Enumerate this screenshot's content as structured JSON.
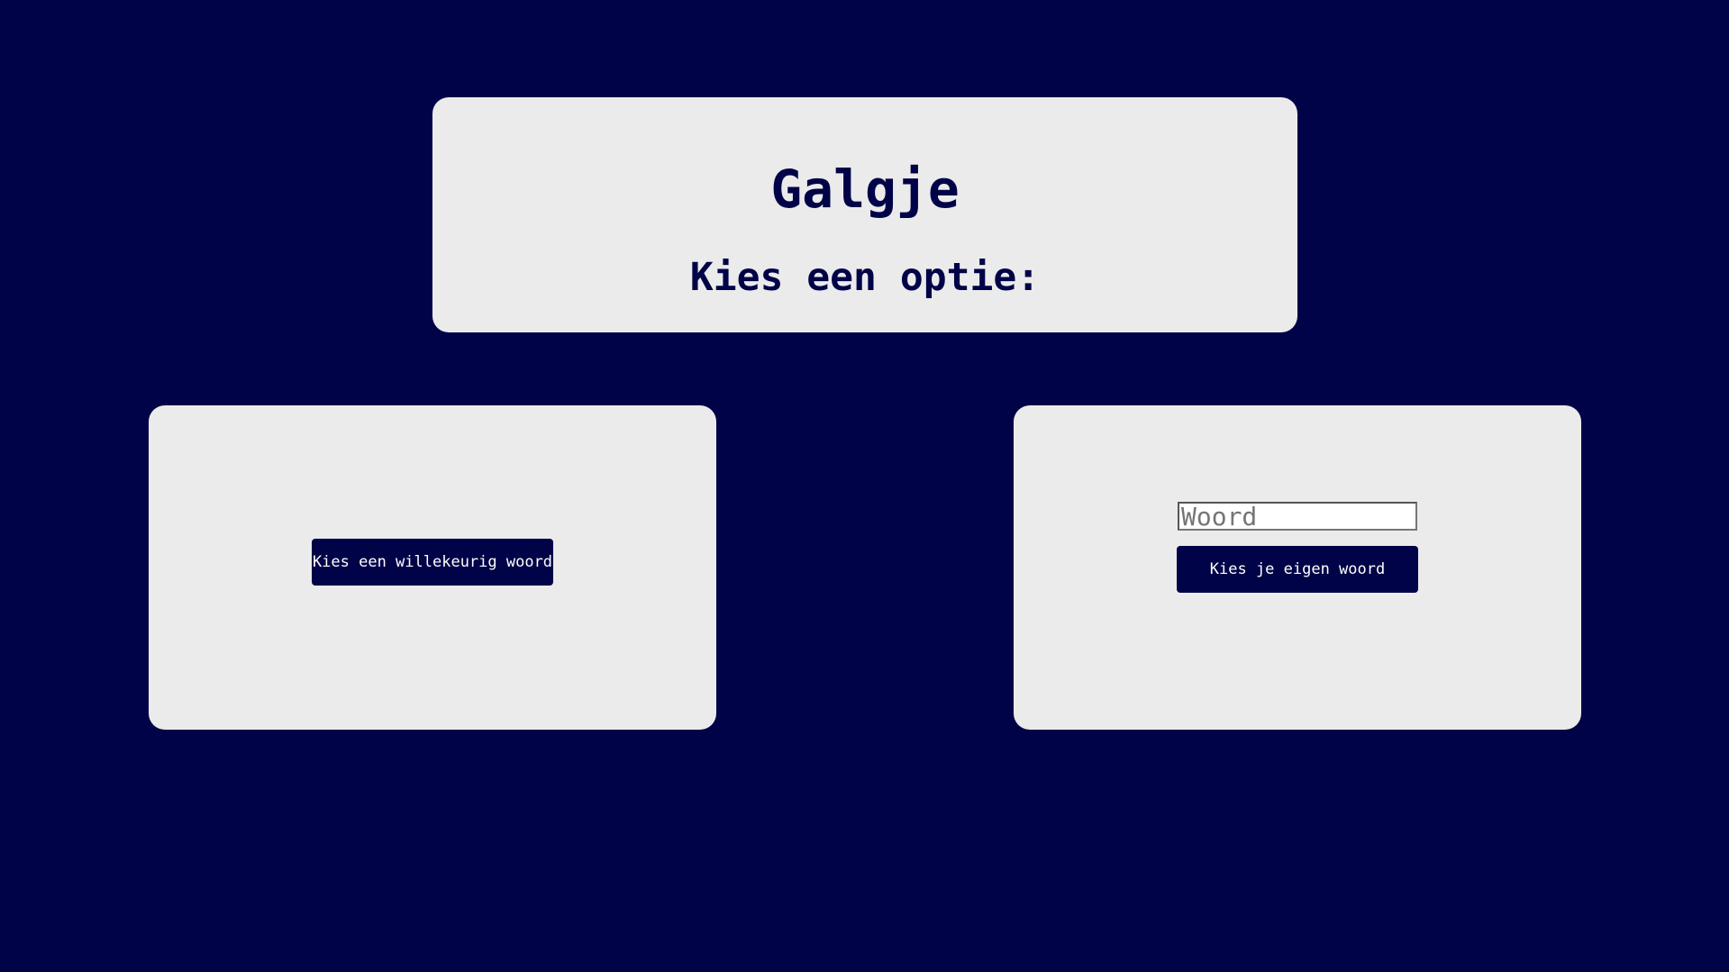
{
  "header": {
    "title": "Galgje",
    "subtitle": "Kies een optie:"
  },
  "random_option": {
    "button_label": "Kies een willekeurig woord"
  },
  "own_option": {
    "input_placeholder": "Woord",
    "input_value": "",
    "button_label": "Kies je eigen woord"
  },
  "colors": {
    "background": "#000347",
    "card": "#ebebeb",
    "accent": "#000347"
  }
}
